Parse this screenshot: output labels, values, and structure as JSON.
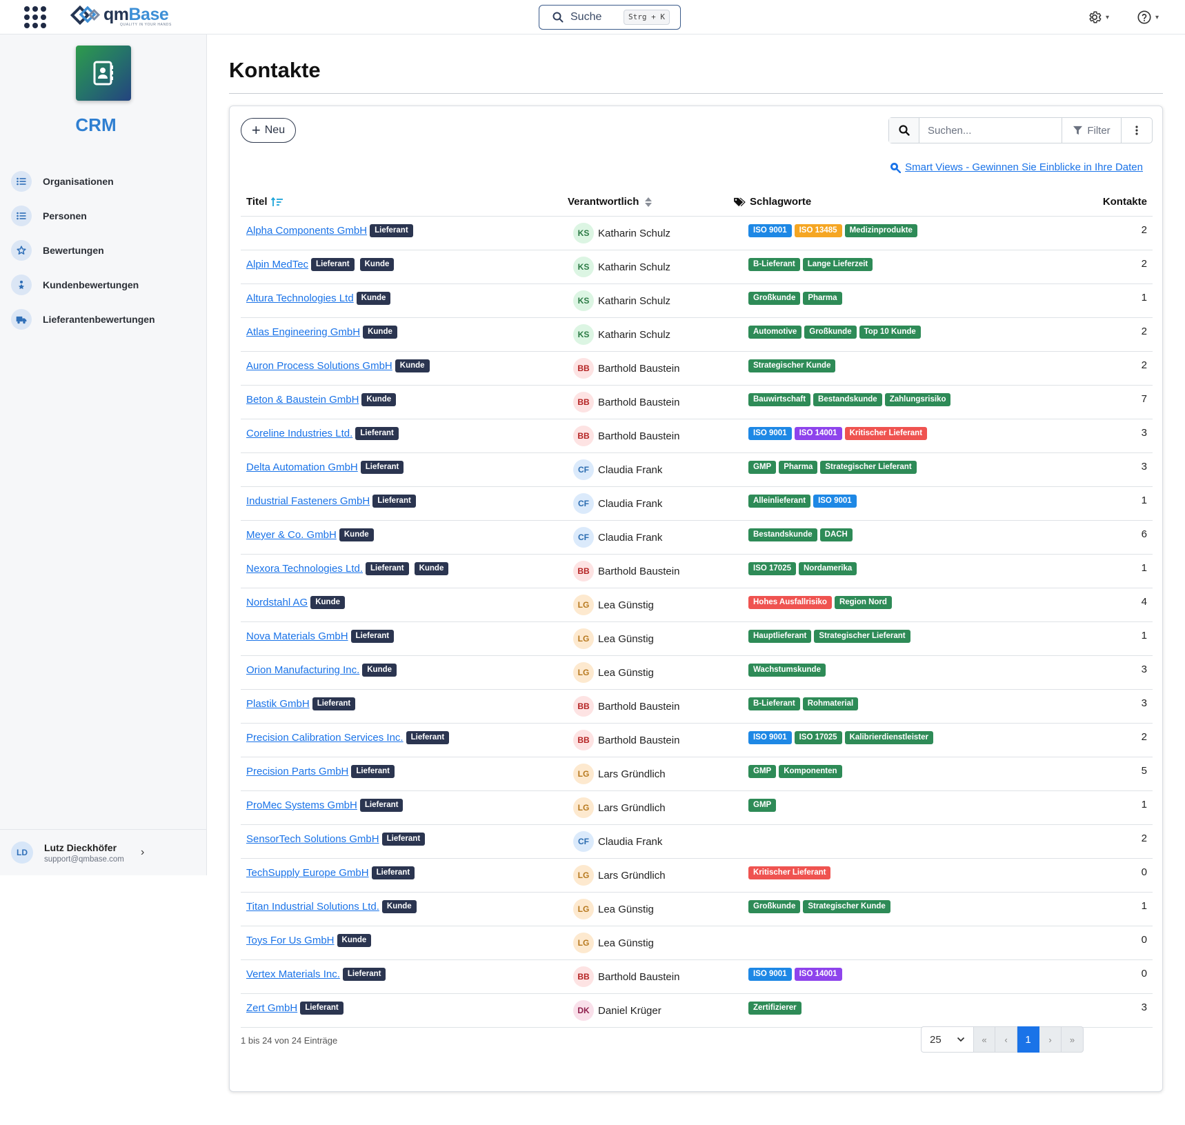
{
  "app": {
    "logo_text_a": "qm",
    "logo_text_b": "Base",
    "logo_sub": "QUALITY IN YOUR HANDS",
    "search_label": "Suche",
    "search_shortcut": "Strg + K"
  },
  "sidebar": {
    "module_title": "CRM",
    "items": [
      {
        "label": "Organisationen",
        "icon": "list-icon"
      },
      {
        "label": "Personen",
        "icon": "list-icon"
      },
      {
        "label": "Bewertungen",
        "icon": "star-icon"
      },
      {
        "label": "Kundenbewertungen",
        "icon": "user-star-icon"
      },
      {
        "label": "Lieferantenbewertungen",
        "icon": "truck-icon"
      }
    ],
    "user": {
      "initials": "LD",
      "name": "Lutz Dieckhöfer",
      "email": "support@qmbase.com"
    }
  },
  "page": {
    "title": "Kontakte",
    "new_button": "Neu",
    "search_placeholder": "Suchen...",
    "filter_label": "Filter",
    "smart_views_link": "Smart Views - Gewinnen Sie Einblicke in Ihre Daten"
  },
  "table": {
    "columns": {
      "title": "Titel",
      "responsible": "Verantwortlich",
      "tags": "Schlagworte",
      "contacts": "Kontakte"
    },
    "rows": [
      {
        "name": "Alpha Components GmbH",
        "types": [
          "Lieferant"
        ],
        "initials": "KS",
        "responsible": "Katharin Schulz",
        "tags": [
          {
            "t": "ISO 9001",
            "c": "#1e88e5"
          },
          {
            "t": "ISO 13485",
            "c": "#f5a623"
          },
          {
            "t": "Medizinprodukte",
            "c": "#2e8b57"
          }
        ],
        "count": "2"
      },
      {
        "name": "Alpin MedTec",
        "types": [
          "Lieferant",
          "Kunde"
        ],
        "initials": "KS",
        "responsible": "Katharin Schulz",
        "tags": [
          {
            "t": "B-Lieferant",
            "c": "#2e8b57"
          },
          {
            "t": "Lange Lieferzeit",
            "c": "#2e8b57"
          }
        ],
        "count": "2"
      },
      {
        "name": "Altura Technologies Ltd",
        "types": [
          "Kunde"
        ],
        "initials": "KS",
        "responsible": "Katharin Schulz",
        "tags": [
          {
            "t": "Großkunde",
            "c": "#2e8b57"
          },
          {
            "t": "Pharma",
            "c": "#2e8b57"
          }
        ],
        "count": "1"
      },
      {
        "name": "Atlas Engineering GmbH",
        "types": [
          "Kunde"
        ],
        "initials": "KS",
        "responsible": "Katharin Schulz",
        "tags": [
          {
            "t": "Automotive",
            "c": "#2e8b57"
          },
          {
            "t": "Großkunde",
            "c": "#2e8b57"
          },
          {
            "t": "Top 10 Kunde",
            "c": "#2e8b57"
          }
        ],
        "count": "2"
      },
      {
        "name": "Auron Process Solutions GmbH",
        "types": [
          "Kunde"
        ],
        "initials": "BB",
        "responsible": "Barthold Baustein",
        "tags": [
          {
            "t": "Strategischer Kunde",
            "c": "#2e8b57"
          }
        ],
        "count": "2"
      },
      {
        "name": "Beton & Baustein GmbH",
        "types": [
          "Kunde"
        ],
        "initials": "BB",
        "responsible": "Barthold Baustein",
        "tags": [
          {
            "t": "Bauwirtschaft",
            "c": "#2e8b57"
          },
          {
            "t": "Bestandskunde",
            "c": "#2e8b57"
          },
          {
            "t": "Zahlungsrisiko",
            "c": "#2e8b57"
          }
        ],
        "count": "7"
      },
      {
        "name": "Coreline Industries Ltd.",
        "types": [
          "Lieferant"
        ],
        "initials": "BB",
        "responsible": "Barthold Baustein",
        "tags": [
          {
            "t": "ISO 9001",
            "c": "#1e88e5"
          },
          {
            "t": "ISO 14001",
            "c": "#8e44ec"
          },
          {
            "t": "Kritischer Lieferant",
            "c": "#ef5350"
          }
        ],
        "count": "3"
      },
      {
        "name": "Delta Automation GmbH",
        "types": [
          "Lieferant"
        ],
        "initials": "CF",
        "responsible": "Claudia Frank",
        "tags": [
          {
            "t": "GMP",
            "c": "#2e8b57"
          },
          {
            "t": "Pharma",
            "c": "#2e8b57"
          },
          {
            "t": "Strategischer Lieferant",
            "c": "#2e8b57"
          }
        ],
        "count": "3"
      },
      {
        "name": "Industrial Fasteners GmbH",
        "types": [
          "Lieferant"
        ],
        "initials": "CF",
        "responsible": "Claudia Frank",
        "tags": [
          {
            "t": "Alleinlieferant",
            "c": "#2e8b57"
          },
          {
            "t": "ISO 9001",
            "c": "#1e88e5"
          }
        ],
        "count": "1"
      },
      {
        "name": "Meyer & Co. GmbH",
        "types": [
          "Kunde"
        ],
        "initials": "CF",
        "responsible": "Claudia Frank",
        "tags": [
          {
            "t": "Bestandskunde",
            "c": "#2e8b57"
          },
          {
            "t": "DACH",
            "c": "#2e8b57"
          }
        ],
        "count": "6"
      },
      {
        "name": "Nexora Technologies Ltd.",
        "types": [
          "Lieferant",
          "Kunde"
        ],
        "initials": "BB",
        "responsible": "Barthold Baustein",
        "tags": [
          {
            "t": "ISO 17025",
            "c": "#2e8b57"
          },
          {
            "t": "Nordamerika",
            "c": "#2e8b57"
          }
        ],
        "count": "1"
      },
      {
        "name": "Nordstahl AG",
        "types": [
          "Kunde"
        ],
        "initials": "LG",
        "responsible": "Lea Günstig",
        "tags": [
          {
            "t": "Hohes Ausfallrisiko",
            "c": "#ef5350"
          },
          {
            "t": "Region Nord",
            "c": "#2e8b57"
          }
        ],
        "count": "4"
      },
      {
        "name": "Nova Materials GmbH",
        "types": [
          "Lieferant"
        ],
        "initials": "LG",
        "responsible": "Lea Günstig",
        "tags": [
          {
            "t": "Hauptlieferant",
            "c": "#2e8b57"
          },
          {
            "t": "Strategischer Lieferant",
            "c": "#2e8b57"
          }
        ],
        "count": "1"
      },
      {
        "name": "Orion Manufacturing Inc.",
        "types": [
          "Kunde"
        ],
        "initials": "LG",
        "responsible": "Lea Günstig",
        "tags": [
          {
            "t": "Wachstumskunde",
            "c": "#2e8b57"
          }
        ],
        "count": "3"
      },
      {
        "name": "Plastik GmbH",
        "types": [
          "Lieferant"
        ],
        "initials": "BB",
        "responsible": "Barthold Baustein",
        "tags": [
          {
            "t": "B-Lieferant",
            "c": "#2e8b57"
          },
          {
            "t": "Rohmaterial",
            "c": "#2e8b57"
          }
        ],
        "count": "3"
      },
      {
        "name": "Precision Calibration Services Inc.",
        "types": [
          "Lieferant"
        ],
        "initials": "BB",
        "responsible": "Barthold Baustein",
        "tags": [
          {
            "t": "ISO 9001",
            "c": "#1e88e5"
          },
          {
            "t": "ISO 17025",
            "c": "#2e8b57"
          },
          {
            "t": "Kalibrierdienstleister",
            "c": "#2e8b57"
          }
        ],
        "count": "2"
      },
      {
        "name": "Precision Parts GmbH",
        "types": [
          "Lieferant"
        ],
        "initials": "LG",
        "responsible": "Lars Gründlich",
        "tags": [
          {
            "t": "GMP",
            "c": "#2e8b57"
          },
          {
            "t": "Komponenten",
            "c": "#2e8b57"
          }
        ],
        "count": "5"
      },
      {
        "name": "ProMec Systems GmbH",
        "types": [
          "Lieferant"
        ],
        "initials": "LG",
        "responsible": "Lars Gründlich",
        "tags": [
          {
            "t": "GMP",
            "c": "#2e8b57"
          }
        ],
        "count": "1"
      },
      {
        "name": "SensorTech Solutions GmbH",
        "types": [
          "Lieferant"
        ],
        "initials": "CF",
        "responsible": "Claudia Frank",
        "tags": [],
        "count": "2"
      },
      {
        "name": "TechSupply Europe GmbH",
        "types": [
          "Lieferant"
        ],
        "initials": "LG",
        "responsible": "Lars Gründlich",
        "tags": [
          {
            "t": "Kritischer Lieferant",
            "c": "#ef5350"
          }
        ],
        "count": "0"
      },
      {
        "name": "Titan Industrial Solutions Ltd.",
        "types": [
          "Kunde"
        ],
        "initials": "LG",
        "responsible": "Lea Günstig",
        "tags": [
          {
            "t": "Großkunde",
            "c": "#2e8b57"
          },
          {
            "t": "Strategischer Kunde",
            "c": "#2e8b57"
          }
        ],
        "count": "1"
      },
      {
        "name": "Toys For Us GmbH",
        "types": [
          "Kunde"
        ],
        "initials": "LG",
        "responsible": "Lea Günstig",
        "tags": [],
        "count": "0"
      },
      {
        "name": "Vertex Materials Inc.",
        "types": [
          "Lieferant"
        ],
        "initials": "BB",
        "responsible": "Barthold Baustein",
        "tags": [
          {
            "t": "ISO 9001",
            "c": "#1e88e5"
          },
          {
            "t": "ISO 14001",
            "c": "#8e44ec"
          }
        ],
        "count": "0"
      },
      {
        "name": "Zert GmbH",
        "types": [
          "Lieferant"
        ],
        "initials": "DK",
        "responsible": "Daniel Krüger",
        "tags": [
          {
            "t": "Zertifizierer",
            "c": "#2e8b57"
          }
        ],
        "count": "3"
      }
    ]
  },
  "footer": {
    "entries_info": "1 bis 24 von 24 Einträge",
    "page_size": "25",
    "pager": {
      "first": "«",
      "prev": "‹",
      "current": "1",
      "next": "›",
      "last": "»"
    }
  },
  "colors": {
    "accent": "#1a73e8",
    "badge_dark": "#2b3550",
    "tag_green": "#2e8b57",
    "tag_blue": "#1e88e5",
    "tag_orange": "#f5a623",
    "tag_purple": "#8e44ec",
    "tag_red": "#ef5350"
  }
}
